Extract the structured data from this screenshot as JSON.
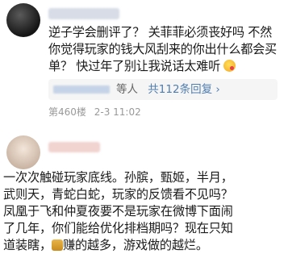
{
  "comment1": {
    "line1": "逆子学会删评了？ 关菲菲必须丧好吗 不然",
    "line2": "你觉得玩家的钱大风刮来的你出什么都会买",
    "line3a": "单？ 快过年了别让我说话太难听",
    "reply_label": "等人",
    "reply_link": "共112条回复",
    "reply_arrow": "›",
    "floor": "第460楼",
    "time": "2-3 11:02"
  },
  "comment2": {
    "line1": "一次次触碰玩家底线。孙膑，甄姬，半月，",
    "line2": "武则天，青蛇白蛇，玩家的反馈看不见吗？",
    "line3": "凤凰于飞和仲夏夜要不是玩家在微博下面闹",
    "line4": "了几年，你们能给优化排档期吗？现在只知",
    "line5a": "道装瞎，",
    "line5b": "赚的越多，游戏做的越烂。"
  }
}
